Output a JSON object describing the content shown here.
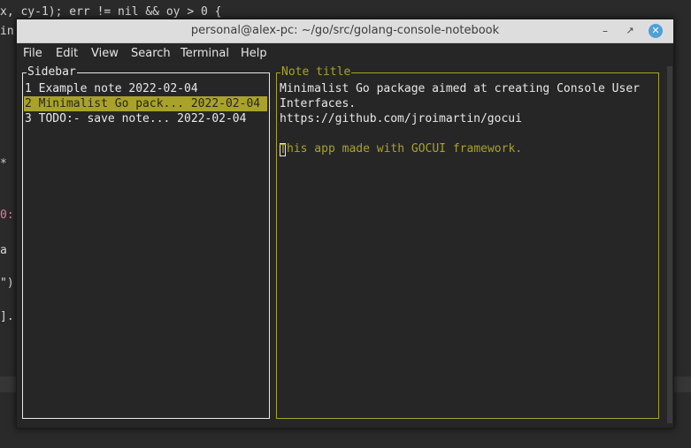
{
  "background_editor": {
    "lines": [
      "x, cy-1); err != nil && oy > 0 {",
      "in",
      "*",
      "0:",
      "a",
      "\")",
      "]."
    ]
  },
  "window": {
    "title": "personal@alex-pc: ~/go/src/golang-console-notebook",
    "minimize_glyph": "–",
    "maximize_glyph": "↗",
    "close_glyph": "✕"
  },
  "menu": {
    "items": [
      {
        "label": "File"
      },
      {
        "label": "Edit"
      },
      {
        "label": "View"
      },
      {
        "label": "Search"
      },
      {
        "label": "Terminal"
      },
      {
        "label": "Help"
      }
    ]
  },
  "sidebar": {
    "title": "Sidebar",
    "notes": [
      {
        "label": "1 Example note 2022-02-04"
      },
      {
        "label": "2 Minimalist Go pack... 2022-02-04"
      },
      {
        "label": "3 TODO:- save note... 2022-02-04"
      }
    ]
  },
  "note": {
    "title": "Note title",
    "lines": [
      "Minimalist Go package aimed at creating Console User",
      "Interfaces.",
      "https://github.com/jroimartin/gocui"
    ],
    "hint": "his app made with GOCUI framework.",
    "hint_first_char": "T"
  },
  "colors": {
    "accent": "#a9a22a",
    "text": "#e8e8e8",
    "background": "#262626",
    "close_button": "#4f9fd8"
  }
}
